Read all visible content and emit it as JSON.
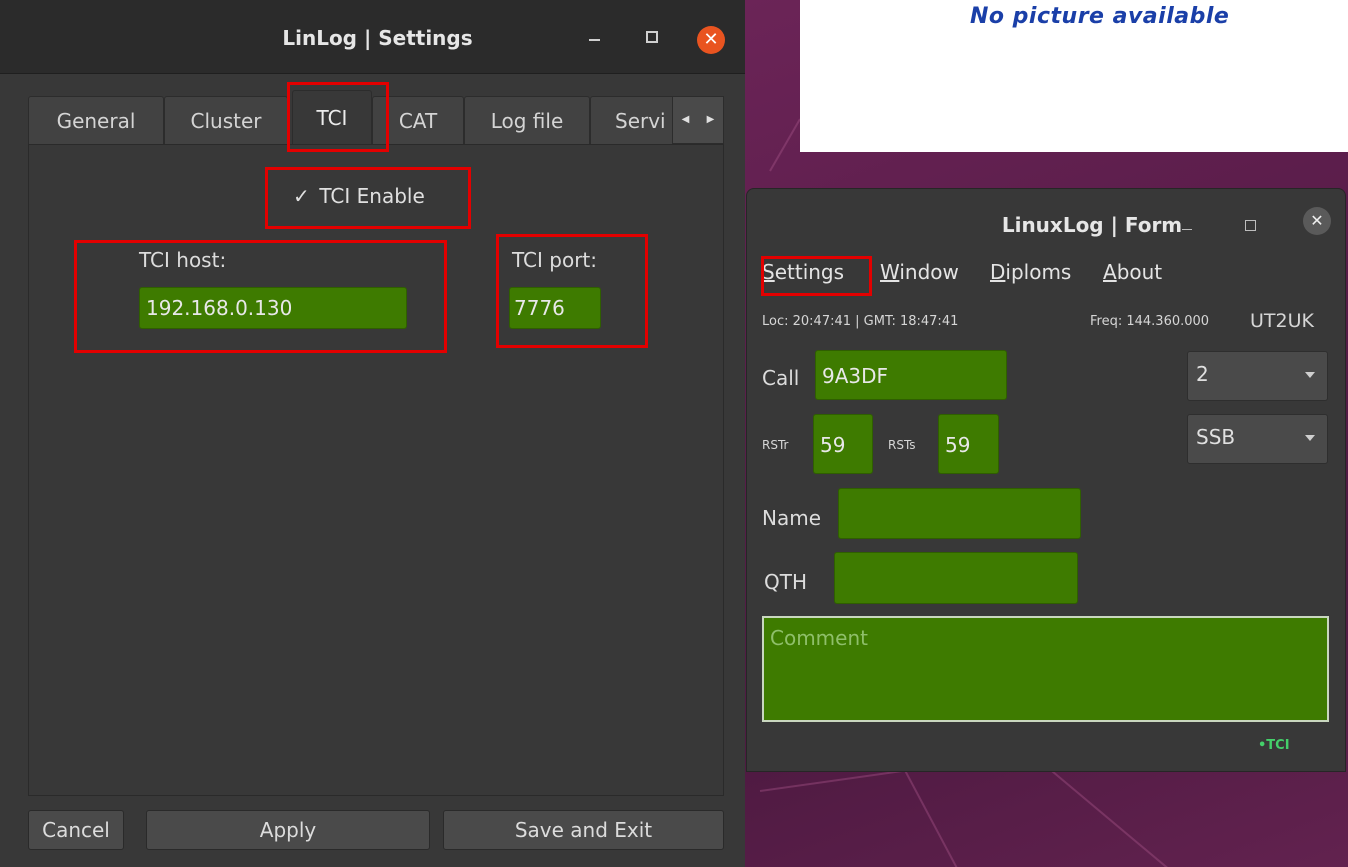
{
  "picture_panel": {
    "text": "No picture available"
  },
  "settings": {
    "title": "LinLog | Settings",
    "close_glyph": "✕",
    "tabs": [
      "General",
      "Cluster",
      "TCI",
      "CAT",
      "Log file",
      "Servi"
    ],
    "tab_scroll": {
      "left": "◀",
      "right": "▶"
    },
    "tci_enable": {
      "check": "✓",
      "label": "TCI Enable"
    },
    "tci_host": {
      "label": "TCI host:",
      "value": "192.168.0.130"
    },
    "tci_port": {
      "label": "TCI port:",
      "value": "7776"
    },
    "buttons": {
      "cancel": "Cancel",
      "apply": "Apply",
      "save_exit": "Save and Exit"
    }
  },
  "form": {
    "title": "LinuxLog | Form",
    "close_glyph": "✕",
    "menu": {
      "settings": {
        "first": "S",
        "rest": "ettings"
      },
      "window": {
        "first": "W",
        "rest": "indow"
      },
      "diploms": {
        "first": "D",
        "rest": "iploms"
      },
      "about": {
        "first": "A",
        "rest": "bout"
      }
    },
    "loc": "Loc: 20:47:41  |  GMT: 18:47:41",
    "freq": "Freq: 144.360.000",
    "callsign": "UT2UK",
    "call": {
      "label": "Call",
      "value": "9A3DF"
    },
    "rstr": {
      "label": "RSTr",
      "value": "59"
    },
    "rsts": {
      "label": "RSTs",
      "value": "59"
    },
    "band_select": "2",
    "mode_select": "SSB",
    "name": {
      "label": "Name",
      "value": ""
    },
    "qth": {
      "label": "QTH",
      "value": ""
    },
    "comment": {
      "placeholder": "Comment"
    },
    "tci_status": "•TCI"
  },
  "colors": {
    "field_green": "#3e7b00",
    "highlight_red": "#e30000",
    "close_orange": "#e95420",
    "tci_status_green": "#44d06a"
  }
}
